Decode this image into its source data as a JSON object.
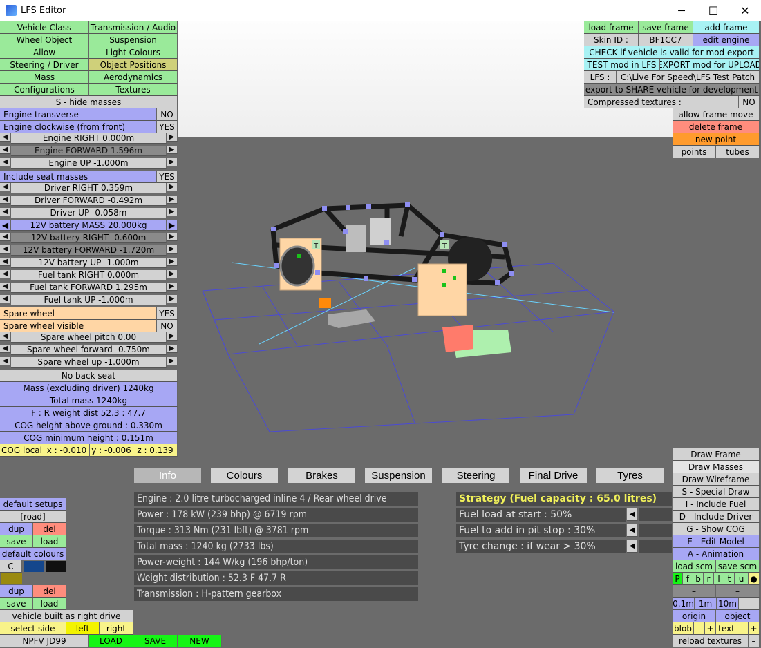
{
  "window": {
    "title": "LFS Editor",
    "minimize": "─",
    "maximize": "☐",
    "close": "✕"
  },
  "left_menu": [
    [
      "Vehicle Class",
      "Transmission / Audio"
    ],
    [
      "Wheel Object",
      "Suspension"
    ],
    [
      "Allow",
      "Light Colours"
    ],
    [
      "Steering / Driver",
      "Object Positions"
    ],
    [
      "Mass",
      "Aerodynamics"
    ],
    [
      "Configurations",
      "Textures"
    ]
  ],
  "left_panel": {
    "hide_masses": "S - hide masses",
    "engine_transverse": {
      "label": "Engine transverse",
      "value": "NO"
    },
    "engine_clockwise": {
      "label": "Engine clockwise (from front)",
      "value": "YES"
    },
    "engine_right": "Engine RIGHT 0.000m",
    "engine_forward": "Engine FORWARD 1.596m",
    "engine_up": "Engine UP -1.000m",
    "include_seat": {
      "label": "Include seat masses",
      "value": "YES"
    },
    "driver_right": "Driver RIGHT 0.359m",
    "driver_forward": "Driver FORWARD -0.492m",
    "driver_up": "Driver UP -0.058m",
    "battery_mass": "12V battery MASS 20.000kg",
    "battery_right": "12V battery RIGHT -0.600m",
    "battery_forward": "12V battery FORWARD -1.720m",
    "battery_up": "12V battery UP -1.000m",
    "fuel_right": "Fuel tank RIGHT 0.000m",
    "fuel_forward": "Fuel tank FORWARD 1.295m",
    "fuel_up": "Fuel tank UP -1.000m",
    "spare_wheel": {
      "label": "Spare wheel",
      "value": "YES"
    },
    "spare_visible": {
      "label": "Spare wheel visible",
      "value": "NO"
    },
    "spare_pitch": "Spare wheel pitch 0.00",
    "spare_forward": "Spare wheel forward -0.750m",
    "spare_up": "Spare wheel up -1.000m",
    "no_back_seat": "No back seat",
    "mass_excl": "Mass (excluding driver) 1240kg",
    "total_mass": "Total mass 1240kg",
    "weight_dist": "F : R  weight dist  52.3 : 47.7",
    "cog_height": "COG height above ground : 0.330m",
    "cog_min": "COG minimum height : 0.151m",
    "cog_local": {
      "label": "COG local",
      "x": "x : -0.010",
      "y": "y : -0.006",
      "z": "z : 0.139"
    }
  },
  "right_top": {
    "load_frame": "load frame",
    "save_frame": "save frame",
    "add_frame": "add frame",
    "skin_label": "Skin ID :",
    "skin_value": "BF1CC7",
    "edit_engine": "edit engine",
    "check_valid": "CHECK if vehicle is valid for mod export",
    "test_mod": "TEST mod in LFS",
    "export_upload": "EXPORT mod for UPLOAD",
    "lfs_label": "LFS :",
    "lfs_path": "C:\\Live For Speed\\LFS Test Patch",
    "export_share": "export to SHARE vehicle for development",
    "compressed_label": "Compressed textures :",
    "compressed_value": "NO",
    "allow_frame_move": "allow frame move",
    "delete_frame": "delete frame",
    "new_point": "new point",
    "points": "points",
    "tubes": "tubes"
  },
  "tabs": [
    "Info",
    "Colours",
    "Brakes",
    "Suspension",
    "Steering",
    "Final Drive",
    "Tyres"
  ],
  "info": [
    "Engine : 2.0 litre turbocharged inline 4 / Rear wheel drive",
    "Power : 178 kW (239 bhp) @ 6719 rpm",
    "Torque : 313 Nm (231 lbft) @ 3781 rpm",
    "Total mass : 1240 kg (2733 lbs)",
    "Power-weight : 144 W/kg (196 bhp/ton)",
    "Weight distribution : 52.3 F  47.7 R",
    "Transmission : H-pattern gearbox"
  ],
  "strategy": {
    "title": "Strategy (Fuel capacity : 65.0 litres)",
    "fuel_load": "Fuel load at start : 50%",
    "fuel_pit": "Fuel to add in pit stop : 30%",
    "tyre_change": "Tyre change : if wear > 30%"
  },
  "bottom_left": {
    "default_setups": "default setups",
    "road": "[road]",
    "dup": "dup",
    "del": "del",
    "save": "save",
    "load": "load",
    "default_colours": "default colours",
    "c": "C",
    "built_right": "vehicle built as right drive",
    "select_side": "select side",
    "left": "left",
    "right": "right",
    "npfv": "NPFV JD99",
    "LOAD": "LOAD",
    "SAVE": "SAVE",
    "NEW": "NEW"
  },
  "right_bottom": {
    "draw_frame": "Draw Frame",
    "draw_masses": "Draw Masses",
    "draw_wireframe": "Draw Wireframe",
    "special_draw": "S - Special Draw",
    "include_fuel": "I - Include Fuel",
    "include_driver": "D - Include Driver",
    "show_cog": "G - Show COG",
    "edit_model": "E - Edit Model",
    "animation": "A - Animation",
    "load_scm": "load scm",
    "save_scm": "save scm",
    "letters": [
      "P",
      "f",
      "b",
      "r",
      "l",
      "t",
      "u",
      "●"
    ],
    "dash": "–",
    "s01": "0.1m",
    "s1": "1m",
    "s10": "10m",
    "minus": "–",
    "origin": "origin",
    "object": "object",
    "blob": "blob",
    "text": "text",
    "plus": "+",
    "reload": "reload textures"
  },
  "colors": {
    "green": "#9aea9a",
    "blue": "#a7a7f4",
    "orange": "#ffd6a5",
    "yellow": "#f8f38a"
  }
}
